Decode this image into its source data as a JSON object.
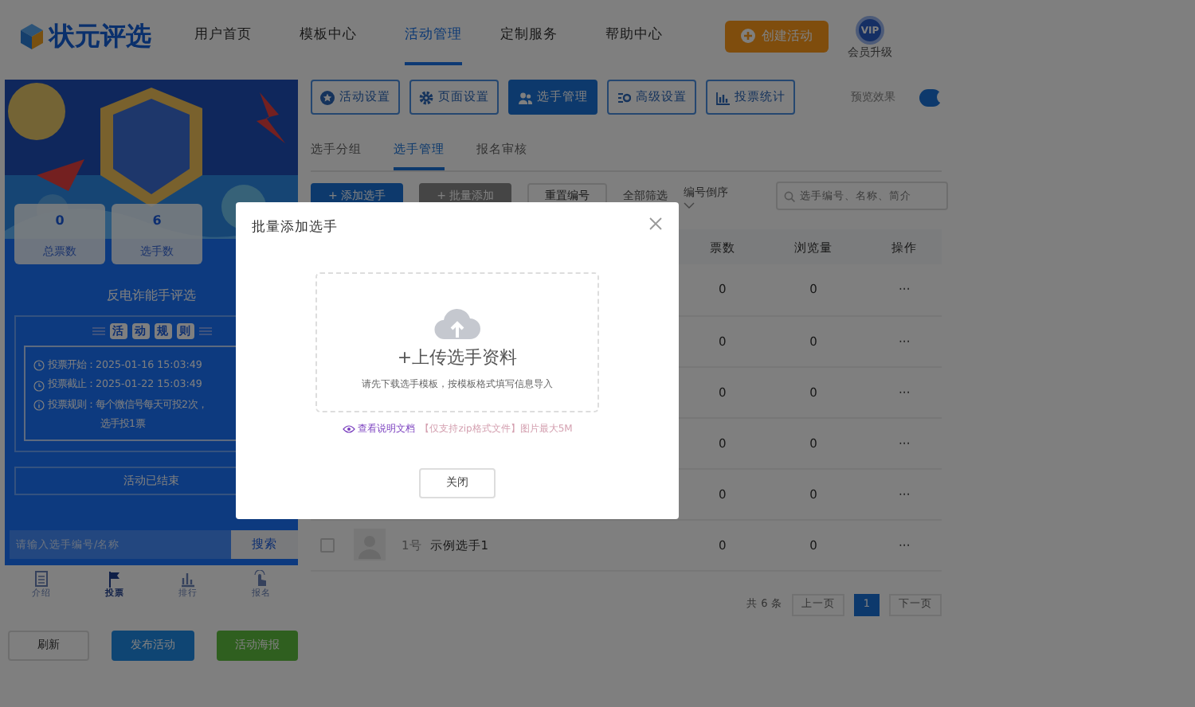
{
  "header": {
    "logo": "状元评选",
    "nav": [
      {
        "label": "用户首页",
        "selected": false
      },
      {
        "label": "模板中心",
        "selected": false
      },
      {
        "label": "活动管理",
        "selected": true
      },
      {
        "label": "定制服务",
        "selected": false
      },
      {
        "label": "帮助中心",
        "selected": false
      }
    ],
    "create_button": "创建活动",
    "vip_badge": "VIP",
    "vip_label": "会员升级"
  },
  "preview": {
    "stats": [
      {
        "value": "0",
        "label": "总票数"
      },
      {
        "value": "6",
        "label": "选手数"
      }
    ],
    "title": "反电诈能手评选",
    "rules_heading": [
      "活",
      "动",
      "规",
      "则"
    ],
    "rules": [
      {
        "kind": "time",
        "text": "投票开始：2025-01-16 15:03:49"
      },
      {
        "kind": "time",
        "text": "投票截止：2025-01-22 15:03:49"
      },
      {
        "kind": "info",
        "text": "投票规则：每个微信号每天可投2次，",
        "continuation": "选手投1票"
      }
    ],
    "status": "活动已结束",
    "search": {
      "placeholder": "请输入选手编号/名称",
      "button": "搜索"
    },
    "tabbar": [
      {
        "kind": "list",
        "label": "介绍",
        "selected": false
      },
      {
        "kind": "flag",
        "label": "投票",
        "selected": true
      },
      {
        "kind": "chart",
        "label": "排行",
        "selected": false
      },
      {
        "kind": "hand",
        "label": "报名",
        "selected": false
      }
    ]
  },
  "actions": [
    {
      "kind": "plain",
      "label": "刷新"
    },
    {
      "kind": "primary",
      "label": "发布活动"
    },
    {
      "kind": "success",
      "label": "活动海报"
    }
  ],
  "toolbar": [
    {
      "kind": "star",
      "label": "活动设置",
      "selected": false
    },
    {
      "kind": "gear",
      "label": "页面设置",
      "selected": false
    },
    {
      "kind": "users",
      "label": "选手管理",
      "selected": true
    },
    {
      "kind": "sliders",
      "label": "高级设置",
      "selected": false
    },
    {
      "kind": "chart",
      "label": "投票统计",
      "selected": false
    }
  ],
  "preview_toggle": {
    "label": "预览效果",
    "on": true
  },
  "subtabs": [
    {
      "label": "选手分组",
      "selected": false
    },
    {
      "label": "选手管理",
      "selected": true
    },
    {
      "label": "报名审核",
      "selected": false
    }
  ],
  "controls": {
    "add_button": "+ 添加选手",
    "batch_button": "+ 批量添加",
    "reset_button": "重置编号",
    "filter": "全部筛选",
    "sort": "编号倒序",
    "search_placeholder": "选手编号、名称、简介"
  },
  "table": {
    "columns": [
      "票数",
      "浏览量",
      "操作"
    ],
    "rows": [
      {
        "votes": "0",
        "views": "0",
        "action": "···"
      },
      {
        "votes": "0",
        "views": "0",
        "action": "···"
      },
      {
        "votes": "0",
        "views": "0",
        "action": "···"
      },
      {
        "votes": "0",
        "views": "0",
        "action": "···"
      },
      {
        "votes": "0",
        "views": "0",
        "action": "···"
      },
      {
        "checked": false,
        "number": "1号",
        "name": "示例选手1",
        "votes": "0",
        "views": "0",
        "action": "···"
      }
    ]
  },
  "pagination": {
    "total": "共 6 条",
    "prev": "上一页",
    "pages": [
      {
        "label": "1",
        "selected": true
      }
    ],
    "next": "下一页"
  },
  "modal": {
    "title": "批量添加选手",
    "upload_title": "+上传选手资料",
    "upload_hint": "请先下载选手模板，按模板格式填写信息导入",
    "doc_link": "查看说明文档",
    "note": "【仅支持zip格式文件】图片最大5M",
    "close_button": "关闭"
  }
}
